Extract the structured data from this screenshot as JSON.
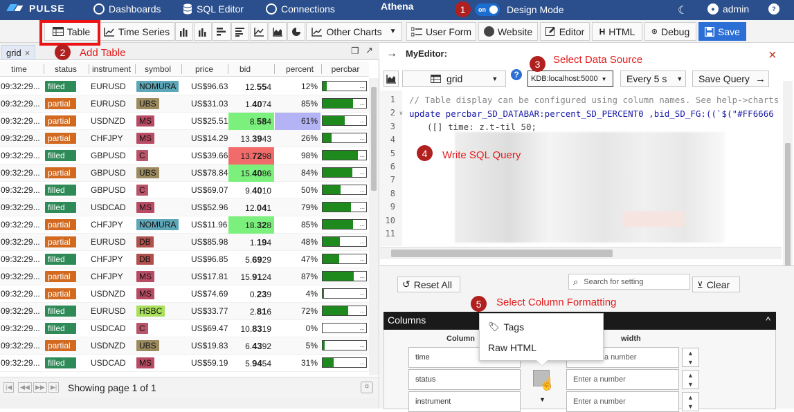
{
  "topbar": {
    "brand": "PULSE",
    "dashboards": "Dashboards",
    "sql_editor": "SQL Editor",
    "connections": "Connections",
    "title": "Athena",
    "toggle": "on",
    "design_mode": "Design Mode",
    "user": "admin",
    "help": "?"
  },
  "toolbar": {
    "table": "Table",
    "time_series": "Time Series",
    "other_charts": "Other Charts",
    "user_form": "User Form",
    "website": "Website",
    "editor": "Editor",
    "html": "HTML",
    "debug": "Debug",
    "save": "Save"
  },
  "annotations": [
    {
      "num": "1",
      "label": ""
    },
    {
      "num": "2",
      "label": "Add Table"
    },
    {
      "num": "3",
      "label": "Select Data Source"
    },
    {
      "num": "4",
      "label": "Write SQL Query"
    },
    {
      "num": "5",
      "label": "Select Column Formatting"
    }
  ],
  "grid": {
    "tab": "grid",
    "tab_close": "×",
    "columns": [
      "time",
      "status",
      "instrument",
      "symbol",
      "price",
      "bid",
      "percent",
      "percbar"
    ],
    "rows": [
      {
        "time": "09:32:29...",
        "status": "filled",
        "instrument": "EURUSD",
        "symbol": "NOMURA",
        "price": "US$96.63",
        "bid_a": "12.",
        "bid_b": "55",
        "bid_c": "4",
        "pct": "12%",
        "bar": 12,
        "bid_bg": "",
        "pct_bg": ""
      },
      {
        "time": "09:32:29...",
        "status": "partial",
        "instrument": "EURUSD",
        "symbol": "UBS",
        "price": "US$31.03",
        "bid_a": "1.",
        "bid_b": "40",
        "bid_c": "74",
        "pct": "85%",
        "bar": 85,
        "bid_bg": "",
        "pct_bg": ""
      },
      {
        "time": "09:32:29...",
        "status": "partial",
        "instrument": "USDNZD",
        "symbol": "MS",
        "price": "US$25.51",
        "bid_a": "8.",
        "bid_b": "58",
        "bid_c": "4",
        "pct": "61%",
        "bar": 61,
        "bid_bg": "#7cf07c",
        "pct_bg": "#b3b3f5"
      },
      {
        "time": "09:32:29...",
        "status": "partial",
        "instrument": "CHFJPY",
        "symbol": "MS",
        "price": "US$14.29",
        "bid_a": "13.",
        "bid_b": "39",
        "bid_c": "43",
        "pct": "26%",
        "bar": 26,
        "bid_bg": "",
        "pct_bg": ""
      },
      {
        "time": "09:32:29...",
        "status": "filled",
        "instrument": "GBPUSD",
        "symbol": "C",
        "price": "US$39.66",
        "bid_a": "13.",
        "bid_b": "72",
        "bid_c": "98",
        "pct": "98%",
        "bar": 98,
        "bid_bg": "#f26b6b",
        "pct_bg": ""
      },
      {
        "time": "09:32:29...",
        "status": "partial",
        "instrument": "GBPUSD",
        "symbol": "UBS",
        "price": "US$78.84",
        "bid_a": "15.",
        "bid_b": "40",
        "bid_c": "86",
        "pct": "84%",
        "bar": 84,
        "bid_bg": "#7cf07c",
        "pct_bg": ""
      },
      {
        "time": "09:32:29...",
        "status": "filled",
        "instrument": "GBPUSD",
        "symbol": "C",
        "price": "US$69.07",
        "bid_a": "9.",
        "bid_b": "40",
        "bid_c": "10",
        "pct": "50%",
        "bar": 50,
        "bid_bg": "",
        "pct_bg": ""
      },
      {
        "time": "09:32:29...",
        "status": "filled",
        "instrument": "USDCAD",
        "symbol": "MS",
        "price": "US$52.96",
        "bid_a": "12.",
        "bid_b": "04",
        "bid_c": "1",
        "pct": "79%",
        "bar": 79,
        "bid_bg": "",
        "pct_bg": ""
      },
      {
        "time": "09:32:29...",
        "status": "partial",
        "instrument": "CHFJPY",
        "symbol": "NOMURA",
        "price": "US$11.96",
        "bid_a": "18.",
        "bid_b": "32",
        "bid_c": "8",
        "pct": "85%",
        "bar": 85,
        "bid_bg": "#7cf07c",
        "pct_bg": ""
      },
      {
        "time": "09:32:29...",
        "status": "partial",
        "instrument": "EURUSD",
        "symbol": "DB",
        "price": "US$85.98",
        "bid_a": "1.",
        "bid_b": "19",
        "bid_c": "4",
        "pct": "48%",
        "bar": 48,
        "bid_bg": "",
        "pct_bg": ""
      },
      {
        "time": "09:32:29...",
        "status": "filled",
        "instrument": "CHFJPY",
        "symbol": "DB",
        "price": "US$96.85",
        "bid_a": "5.",
        "bid_b": "69",
        "bid_c": "29",
        "pct": "47%",
        "bar": 47,
        "bid_bg": "",
        "pct_bg": ""
      },
      {
        "time": "09:32:29...",
        "status": "partial",
        "instrument": "CHFJPY",
        "symbol": "MS",
        "price": "US$17.81",
        "bid_a": "15.",
        "bid_b": "91",
        "bid_c": "24",
        "pct": "87%",
        "bar": 87,
        "bid_bg": "",
        "pct_bg": ""
      },
      {
        "time": "09:32:29...",
        "status": "partial",
        "instrument": "USDNZD",
        "symbol": "MS",
        "price": "US$74.69",
        "bid_a": "0.",
        "bid_b": "23",
        "bid_c": "9",
        "pct": "4%",
        "bar": 4,
        "bid_bg": "",
        "pct_bg": ""
      },
      {
        "time": "09:32:29...",
        "status": "filled",
        "instrument": "EURUSD",
        "symbol": "HSBC",
        "price": "US$33.77",
        "bid_a": "2.",
        "bid_b": "81",
        "bid_c": "6",
        "pct": "72%",
        "bar": 72,
        "bid_bg": "",
        "pct_bg": ""
      },
      {
        "time": "09:32:29...",
        "status": "filled",
        "instrument": "USDCAD",
        "symbol": "C",
        "price": "US$69.47",
        "bid_a": "10.",
        "bid_b": "83",
        "bid_c": "19",
        "pct": "0%",
        "bar": 0,
        "bid_bg": "",
        "pct_bg": ""
      },
      {
        "time": "09:32:29...",
        "status": "partial",
        "instrument": "USDNZD",
        "symbol": "UBS",
        "price": "US$19.83",
        "bid_a": "6.",
        "bid_b": "43",
        "bid_c": "92",
        "pct": "5%",
        "bar": 5,
        "bid_bg": "",
        "pct_bg": ""
      },
      {
        "time": "09:32:29...",
        "status": "filled",
        "instrument": "USDCAD",
        "symbol": "MS",
        "price": "US$59.19",
        "bid_a": "5.",
        "bid_b": "94",
        "bid_c": "54",
        "pct": "31%",
        "bar": 31,
        "bid_bg": "",
        "pct_bg": ""
      }
    ],
    "bar_more": "...",
    "pager_text": "Showing page 1 of 1"
  },
  "editor": {
    "title": "MyEditor:",
    "close": "×",
    "grid_select": "grid",
    "help": "?",
    "datasource": "KDB:localhost:5000",
    "refresh": "Every 5 s",
    "save_query": "Save Query",
    "line_numbers": [
      "1",
      "2",
      "3",
      "4",
      "5",
      "6",
      "7",
      "8",
      "9",
      "10",
      "11"
    ],
    "code_line1": "// Table display can be configured using column names. See help->charts",
    "code_line2": "update percbar_SD_DATABAR:percent_SD_PERCENT0 ,bid_SD_FG:((`$(\"#FF6666",
    "code_line3": "([] time: z.t-til 50;"
  },
  "settings": {
    "reset_all": "Reset All",
    "search_placeholder": "Search for setting",
    "clear": "Clear",
    "columns_title": "Columns",
    "collapse": "^",
    "column_header": "Column",
    "width_header": "width",
    "fields": [
      "time",
      "status",
      "instrument"
    ],
    "width_placeholder": "Enter a number",
    "width_partial": "a number"
  },
  "popup": {
    "tags": "Tags",
    "raw_html": "Raw HTML"
  }
}
